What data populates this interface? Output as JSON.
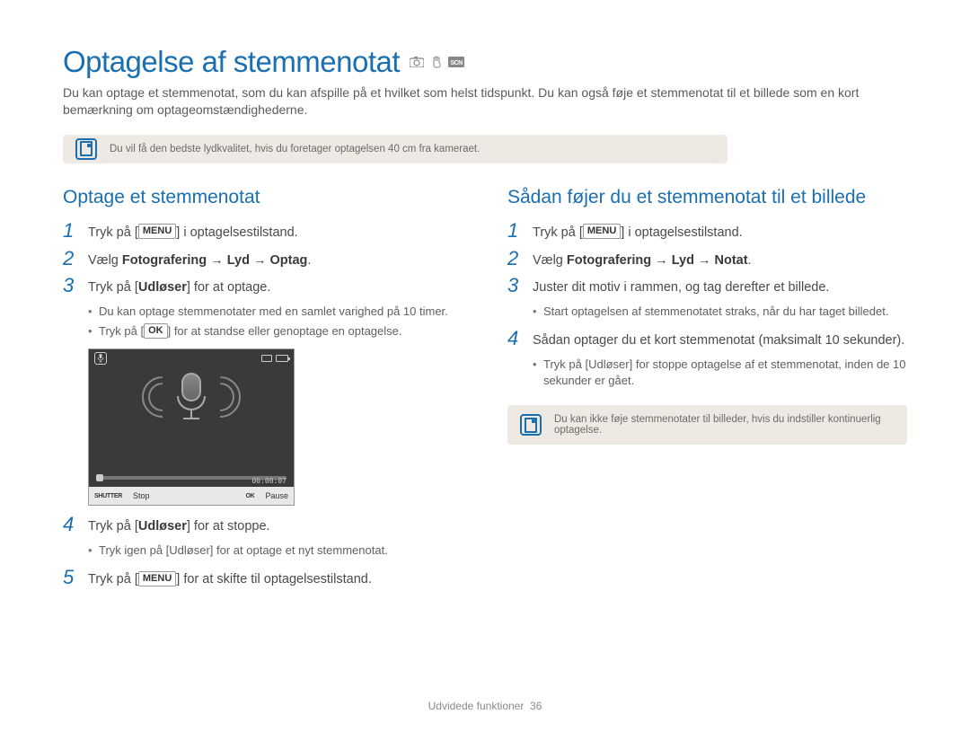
{
  "page": {
    "title": "Optagelse af stemmenotat",
    "intro": "Du kan optage et stemmenotat, som du kan afspille på et hvilket som helst tidspunkt. Du kan også føje et stemmenotat til et billede som en kort bemærkning om optageomstændighederne.",
    "footer_section": "Udvidede funktioner",
    "footer_page": "36"
  },
  "tip1": "Du vil få den bedste lydkvalitet, hvis du foretager optagelsen 40 cm fra kameraet.",
  "left": {
    "heading": "Optage et stemmenotat",
    "step1_pre": "Tryk på [",
    "step1_key": "MENU",
    "step1_post": "] i optagelsestilstand.",
    "step2_pre": "Vælg ",
    "step2_bold": "Fotografering → Lyd → Optag",
    "step2_post": ".",
    "step3_pre": "Tryk på [",
    "step3_bold": "Udløser",
    "step3_post": "] for at optage.",
    "step3_b1": "Du kan optage stemmenotater med en samlet varighed på 10 timer.",
    "step3_b2_pre": "Tryk på [",
    "step3_b2_key": "OK",
    "step3_b2_post": "] for at standse eller genoptage en optagelse.",
    "step4_pre": "Tryk på [",
    "step4_bold": "Udløser",
    "step4_post": "] for at stoppe.",
    "step4_b1_pre": "Tryk igen på [",
    "step4_b1_bold": "Udløser",
    "step4_b1_post": "] for at optage et nyt stemmenotat.",
    "step5_pre": "Tryk på [",
    "step5_key": "MENU",
    "step5_post": "] for at skifte til optagelsestilstand."
  },
  "right": {
    "heading": "Sådan føjer du et stemmenotat til et billede",
    "step1_pre": "Tryk på [",
    "step1_key": "MENU",
    "step1_post": "] i optagelsestilstand.",
    "step2_pre": "Vælg ",
    "step2_bold": "Fotografering → Lyd → Notat",
    "step2_post": ".",
    "step3": "Juster dit motiv i rammen, og tag derefter et billede.",
    "step3_b1": "Start optagelsen af stemmenotatet straks, når du har taget billedet.",
    "step4": "Sådan optager du et kort stemmenotat (maksimalt 10 sekunder).",
    "step4_b1_pre": "Tryk på [",
    "step4_b1_bold": "Udløser",
    "step4_b1_post": "] for stoppe optagelse af et stemmenotat, inden de 10 sekunder er gået.",
    "tip2": "Du kan ikke føje stemmenotater til billeder, hvis du indstiller kontinuerlig optagelse."
  },
  "screenshot": {
    "time": "00:00:07",
    "shutter_label": "SHUTTER",
    "stop": "Stop",
    "ok_label": "OK",
    "pause": "Pause"
  }
}
